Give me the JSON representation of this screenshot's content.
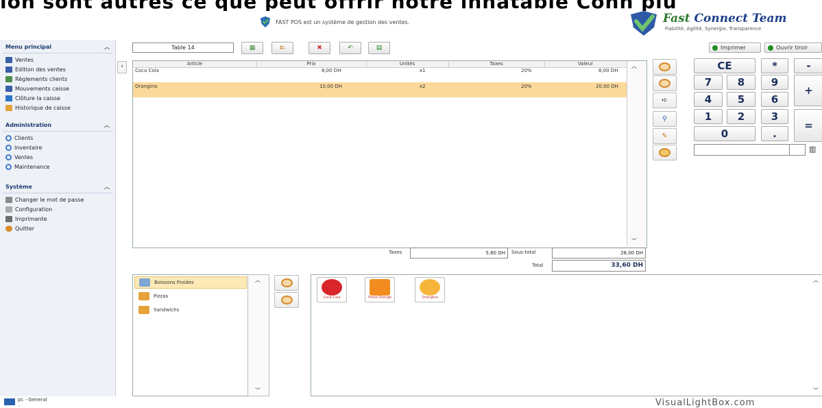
{
  "top_caption": "ion sont autres ce que peut offrir notre innatable Conn plu",
  "header": {
    "message": "FAST POS est un système de gestion des ventes.",
    "brand_name_fast": "Fast",
    "brand_name_rest": "Connect Team",
    "brand_tagline": "Fiabilité, Agilité, Synergie, Transparence"
  },
  "sidebar": {
    "sections": [
      {
        "title": "Menu principal",
        "items": [
          {
            "label": "Ventes",
            "icon": "sales-icon"
          },
          {
            "label": "Edition des ventes",
            "icon": "edit-sales-icon"
          },
          {
            "label": "Règlements clients",
            "icon": "payments-icon"
          },
          {
            "label": "Mouvements caisse",
            "icon": "cash-movements-icon"
          },
          {
            "label": "Clôture la caisse",
            "icon": "close-register-icon"
          },
          {
            "label": "Historique de caisse",
            "icon": "history-icon"
          }
        ]
      },
      {
        "title": "Administration",
        "items": [
          {
            "label": "Clients",
            "icon": "clients-icon"
          },
          {
            "label": "Inventaire",
            "icon": "inventory-icon"
          },
          {
            "label": "Ventes",
            "icon": "sales-admin-icon"
          },
          {
            "label": "Maintenance",
            "icon": "maintenance-icon"
          }
        ]
      },
      {
        "title": "Système",
        "items": [
          {
            "label": "Changer le mot de passe",
            "icon": "key-icon"
          },
          {
            "label": "Configuration",
            "icon": "config-icon"
          },
          {
            "label": "Imprimante",
            "icon": "printer-icon"
          },
          {
            "label": "Quitter",
            "icon": "quit-icon"
          }
        ]
      }
    ]
  },
  "toolbar": {
    "table_value": "Table 14",
    "print_label": "Imprimer",
    "drawer_label": "Ouvrir tiroir"
  },
  "ticket": {
    "columns": [
      "Article",
      "Prix",
      "Unités",
      "Taxes",
      "Valeur"
    ],
    "rows": [
      {
        "article": "Coca Cola",
        "prix": "8,00 DH",
        "unites": "x1",
        "taxes": "20%",
        "valeur": "8,00 DH",
        "selected": false
      },
      {
        "article": "Orangina",
        "prix": "10,00 DH",
        "unites": "x2",
        "taxes": "20%",
        "valeur": "20,00 DH",
        "selected": true
      }
    ]
  },
  "totals": {
    "taxes_label": "Taxes",
    "taxes_value": "5,60 DH",
    "subtotal_label": "Sous-total",
    "subtotal_value": "28,00 DH",
    "total_label": "Total",
    "total_value": "33,60 DH"
  },
  "keypad": {
    "keys": [
      "CE",
      "*",
      "-",
      "7",
      "8",
      "9",
      "+",
      "4",
      "5",
      "6",
      "1",
      "2",
      "3",
      "=",
      "0",
      "."
    ]
  },
  "categories": [
    {
      "label": "Boissons Froides",
      "selected": true
    },
    {
      "label": "Pizzas",
      "selected": false
    },
    {
      "label": "Sandwichs",
      "selected": false
    }
  ],
  "products": [
    {
      "label": "Coca-Cola",
      "color": "#d8262b"
    },
    {
      "label": "Fanta Orange",
      "color": "#f28c1e"
    },
    {
      "label": "Orangina",
      "color": "#f6b53a"
    }
  ],
  "status": {
    "user": "pc - General",
    "detail": "..."
  },
  "watermark": "VisualLightBox.com"
}
